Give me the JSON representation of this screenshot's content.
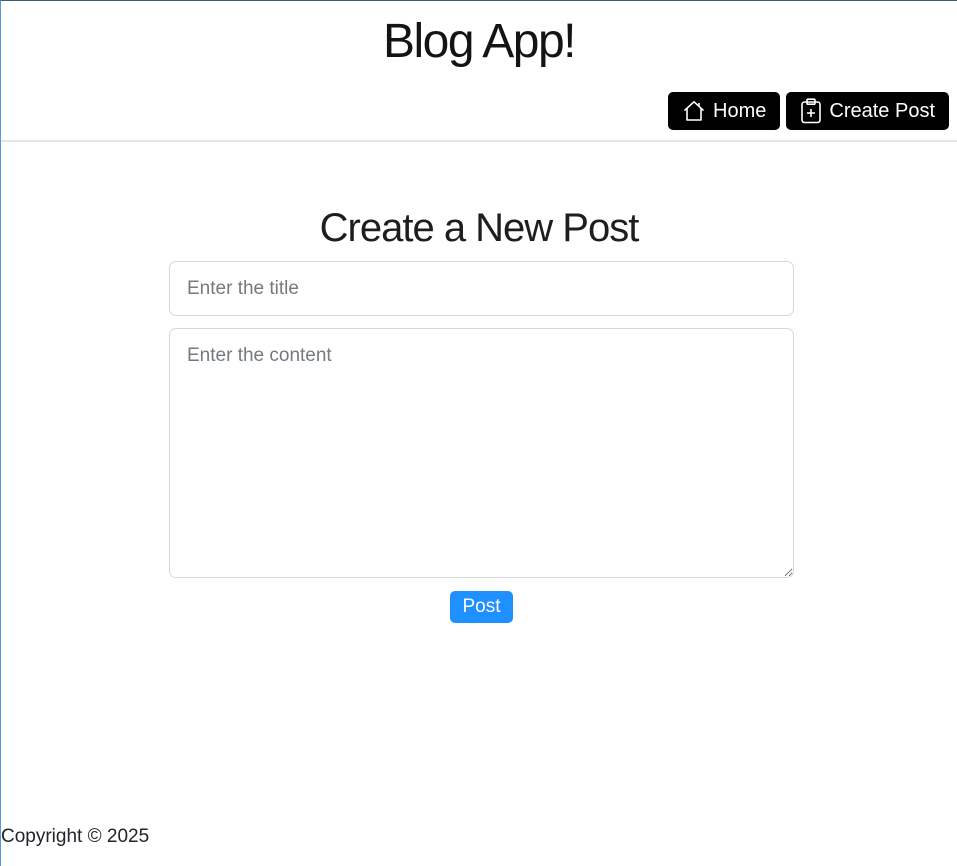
{
  "header": {
    "app_title": "Blog App!",
    "nav": [
      {
        "label": "Home",
        "icon": "home-icon"
      },
      {
        "label": "Create Post",
        "icon": "clipboard-plus-icon"
      }
    ]
  },
  "form": {
    "heading": "Create a New Post",
    "title_placeholder": "Enter the title",
    "title_value": "",
    "content_placeholder": "Enter the content",
    "content_value": "",
    "submit_label": "Post"
  },
  "footer": {
    "copyright": "Copyright © 2025"
  },
  "colors": {
    "nav_button_bg": "#000000",
    "primary_button_bg": "#1e90ff"
  }
}
